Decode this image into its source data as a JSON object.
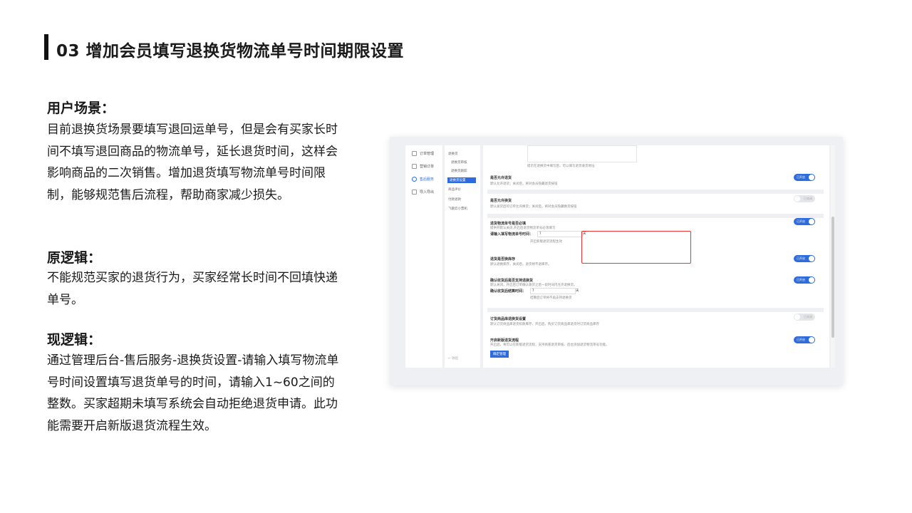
{
  "title": "03 增加会员填写退换货物流单号时间期限设置",
  "sections": {
    "scene": {
      "heading": "用户场景：",
      "body": "目前退换货场景要填写退回运单号，但是会有买家长时间不填写退回商品的物流单号，延长退货时间，这样会影响商品的二次销售。增加退货填写物流单号时间限制，能够规范售后流程，帮助商家减少损失。"
    },
    "old": {
      "heading": "原逻辑：",
      "body": "不能规范买家的退货行为，买家经常长时间不回填快递单号。"
    },
    "new": {
      "heading": "现逻辑：",
      "body": "通过管理后台-售后服务-退换货设置-请输入填写物流单号时间设置填写退货单号的时间，请输入1~60之间的整数。买家超期未填写系统会自动拒绝退货申请。此功能需要开启新版退货流程生效。"
    }
  },
  "screenshot": {
    "sidebar": [
      "订单管理",
      "营销订单",
      "售后服务",
      "导入导出"
    ],
    "submenu": [
      "退换货",
      "退换货审核",
      "退换货跟踪",
      "退换货设置",
      "商品评价",
      "付款退款",
      "飞鹅云小票机"
    ],
    "collapse": "← 收起",
    "hint": "提示在退换货中填写后，可以填写退货收货地址",
    "panels": [
      {
        "title": "是否允许退货",
        "desc": "默认允许退货；关闭后，将对会员隐藏退货按钮",
        "toggle": "已开启"
      },
      {
        "title": "是否允许换货",
        "desc": "默认发货后的订单允许换货；关闭后，将对会员隐藏换货按钮",
        "toggle": "已关闭"
      },
      {
        "title": "退货物流单号是否必填",
        "desc": "提供开默认关闭,开启后退货物流单号必须填写",
        "toggle": "已开启",
        "field": "请输入填写物流单号时间：",
        "value": "7",
        "unit": "天",
        "note": "开启新版退货流程生效"
      },
      {
        "title": "退货是否换库存",
        "desc": "默认退换库存，关闭后，退货将不退库存。",
        "toggle": "已开启"
      },
      {
        "title": "确认收货后是否支持退换货",
        "desc": "默认关闭，开启后订单确认收货之后一段时间内允许退换货。",
        "toggle": "已开启",
        "field": "确认收货后结算时间：",
        "value": "7",
        "unit": "天",
        "note": "结算后订单将不再支持退换货"
      },
      {
        "title": "订货商品库退换货设置",
        "desc": "默认订货商品库退货扣款库存，开启后，购买订货商品库退货时订货商品库存",
        "toggle": "已关闭"
      },
      {
        "title": "开启新版退货流程",
        "desc": "开启后，将可以在新版退货流程，支持商家退货审核、后台添加退货物流单号功能。",
        "toggle": "已开启",
        "button": "确定管理"
      }
    ]
  }
}
